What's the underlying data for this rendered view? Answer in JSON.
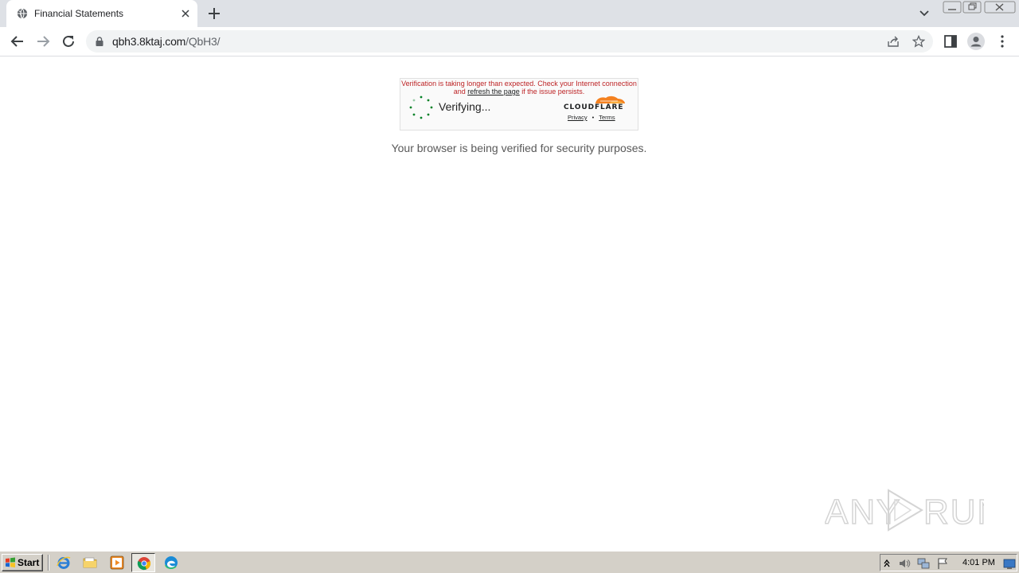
{
  "browser": {
    "tab": {
      "title": "Financial Statements",
      "favicon": "globe-icon"
    },
    "url": {
      "host": "qbh3.8ktaj.com",
      "path": "/QbH3/"
    }
  },
  "page": {
    "cloudflare": {
      "warning_before": "Verification is taking longer than expected. Check your Internet connection and ",
      "warning_link": "refresh the page",
      "warning_after": " if the issue persists.",
      "verifying": "Verifying...",
      "logo_text": "CLOUDFLARE",
      "privacy": "Privacy",
      "separator": "•",
      "terms": "Terms"
    },
    "message": "Your browser is being verified for security purposes."
  },
  "watermark": {
    "text": "ANY RUN"
  },
  "taskbar": {
    "start_label": "Start",
    "clock": "4:01 PM"
  },
  "colors": {
    "warning": "#bd2426",
    "spinner": "#038127",
    "cloudflare_orange": "#f48120",
    "tabstrip": "#dee1e6"
  }
}
